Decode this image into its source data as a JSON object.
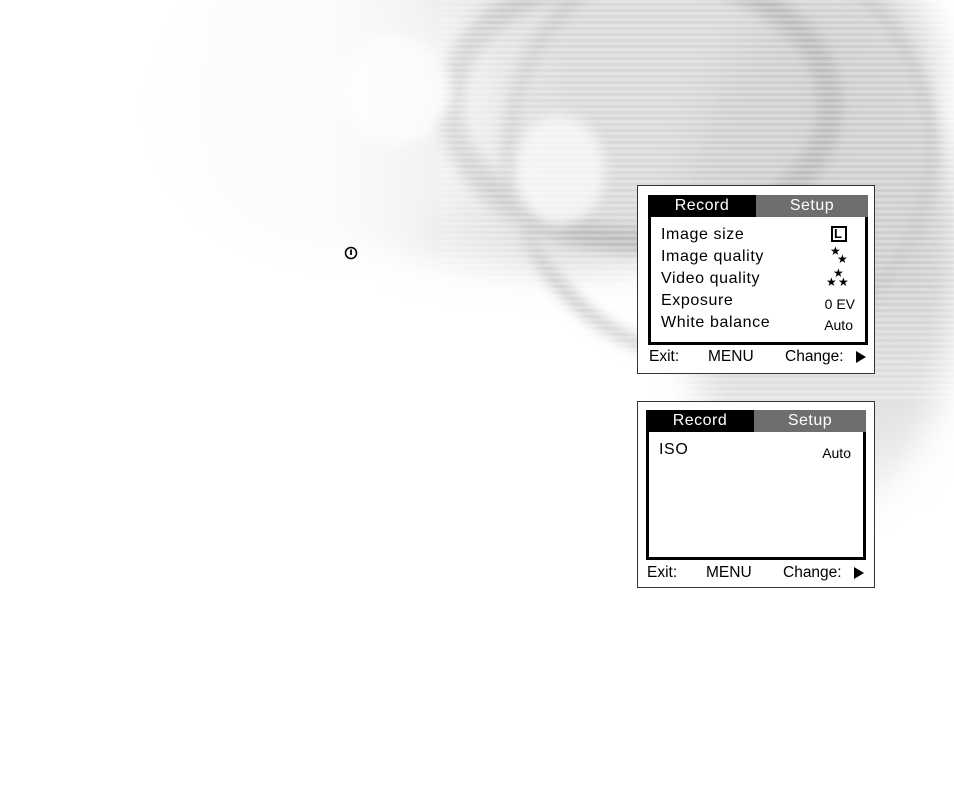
{
  "screens": [
    {
      "tabs": {
        "record": "Record",
        "setup": "Setup"
      },
      "rows": [
        {
          "label": "Image size",
          "value": "L",
          "icon": "image-size-large-icon"
        },
        {
          "label": "Image quality",
          "value": "",
          "icon": "two-star-quality-icon"
        },
        {
          "label": "Video quality",
          "value": "",
          "icon": "three-star-quality-icon"
        },
        {
          "label": "Exposure",
          "value": "0 EV"
        },
        {
          "label": "White balance",
          "value": "Auto"
        }
      ],
      "footer": {
        "exit": "Exit:",
        "menu": "MENU",
        "change": "Change:",
        "arrow_icon": "right-triangle-icon"
      }
    },
    {
      "tabs": {
        "record": "Record",
        "setup": "Setup"
      },
      "rows": [
        {
          "label": "ISO",
          "value": "Auto"
        }
      ],
      "footer": {
        "exit": "Exit:",
        "menu": "MENU",
        "change": "Change:",
        "arrow_icon": "right-triangle-icon"
      }
    }
  ],
  "icons": {
    "power": "power-button-icon"
  },
  "colors": {
    "tab_active_bg": "#000000",
    "tab_inactive_bg": "#6e6e6e",
    "tab_text": "#ffffff"
  }
}
